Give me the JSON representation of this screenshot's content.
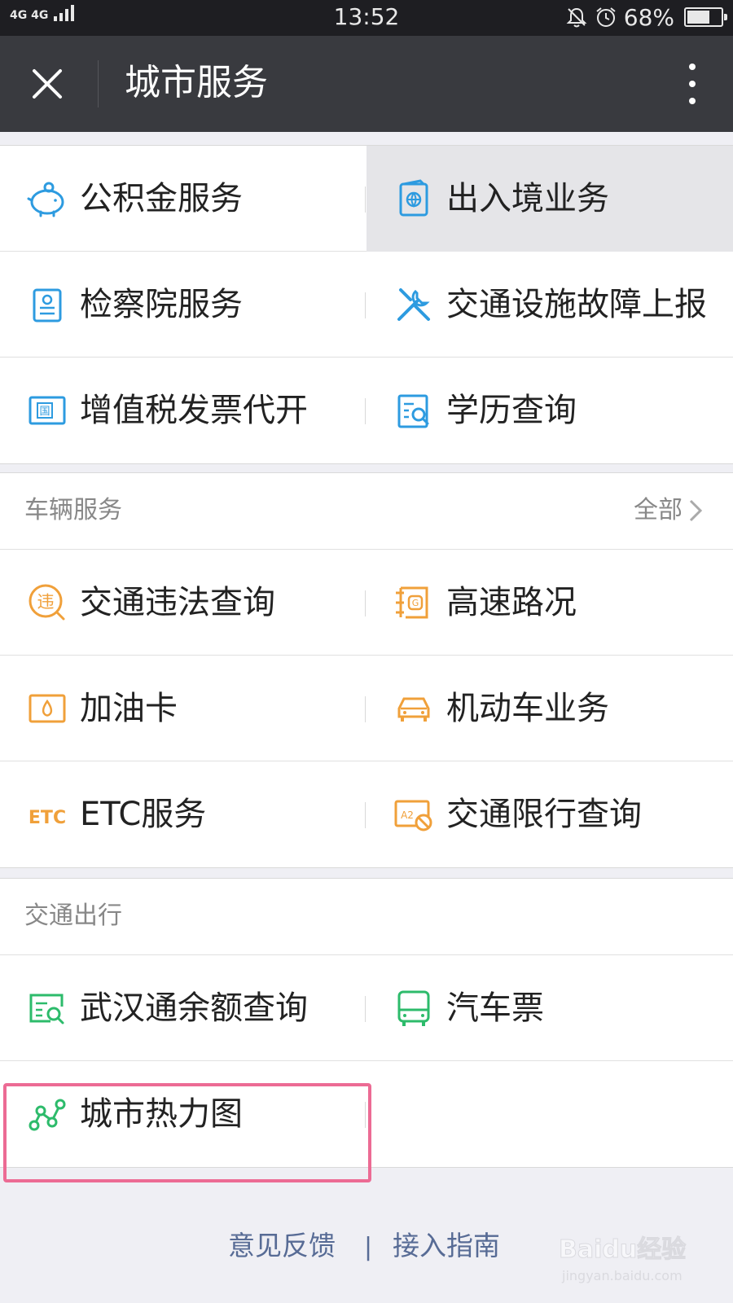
{
  "status_bar": {
    "signal": "4G 4G",
    "time": "13:52",
    "battery": "68%",
    "battery_level": 0.68
  },
  "header": {
    "title": "城市服务",
    "close_icon": "close-icon",
    "more_icon": "more-vertical-icon"
  },
  "section_1": {
    "rows": [
      {
        "left": {
          "label": "公积金服务",
          "icon": "piggy-bank-icon"
        },
        "right": {
          "label": "出入境业务",
          "icon": "passport-icon"
        }
      },
      {
        "left": {
          "label": "检察院服务",
          "icon": "badge-icon"
        },
        "right": {
          "label": "交通设施故障上报",
          "icon": "tools-icon"
        }
      },
      {
        "left": {
          "label": "增值税发票代开",
          "icon": "invoice-icon"
        },
        "right": {
          "label": "学历查询",
          "icon": "document-search-icon"
        }
      }
    ]
  },
  "vehicle": {
    "title": "车辆服务",
    "all_label": "全部",
    "rows": [
      {
        "left": {
          "label": "交通违法查询",
          "icon": "violation-icon",
          "glyph": "违"
        },
        "right": {
          "label": "高速路况",
          "icon": "highway-icon"
        }
      },
      {
        "left": {
          "label": "加油卡",
          "icon": "fuel-card-icon"
        },
        "right": {
          "label": "机动车业务",
          "icon": "car-icon"
        }
      },
      {
        "left": {
          "label": "ETC服务",
          "icon": "etc-icon",
          "glyph": "ETC"
        },
        "right": {
          "label": "交通限行查询",
          "icon": "restriction-icon",
          "glyph": "A2"
        }
      }
    ]
  },
  "transit": {
    "title": "交通出行",
    "rows": [
      {
        "left": {
          "label": "武汉通余额查询",
          "icon": "card-search-icon"
        },
        "right": {
          "label": "汽车票",
          "icon": "bus-icon"
        }
      },
      {
        "left": {
          "label": "城市热力图",
          "icon": "heatmap-nodes-icon"
        }
      }
    ]
  },
  "footer": {
    "feedback": "意见反馈",
    "separator": "|",
    "guide": "接入指南"
  },
  "watermark": {
    "brand": "Baidu经验",
    "url": "jingyan.baidu.com"
  },
  "colors": {
    "blue": "#2d9be0",
    "orange": "#f0a03a",
    "green": "#2dbb6b",
    "highlight": "#ec6b94",
    "link": "#576b95"
  }
}
